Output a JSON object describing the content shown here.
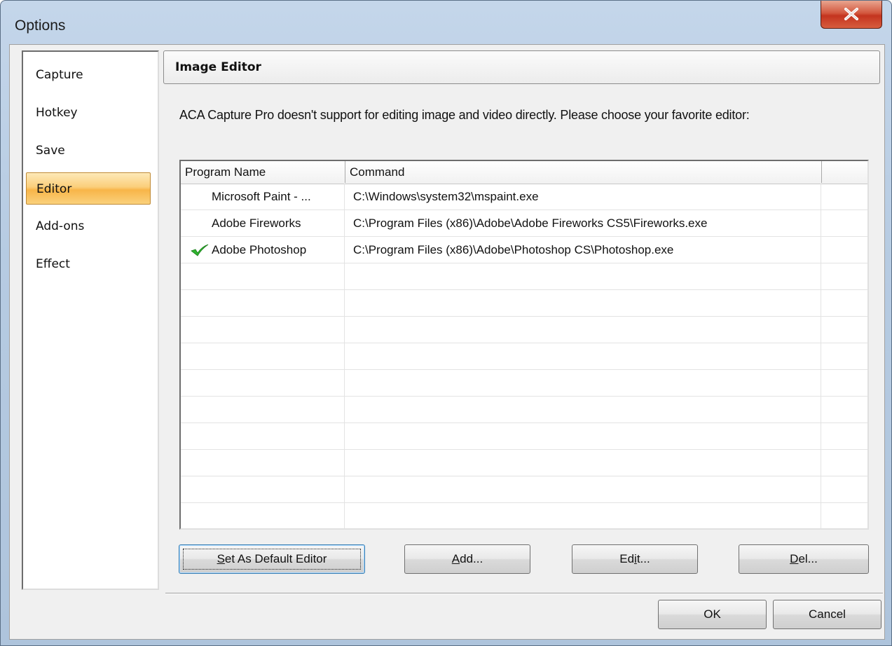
{
  "window": {
    "title": "Options"
  },
  "sidebar": {
    "items": [
      {
        "label": "Capture"
      },
      {
        "label": "Hotkey"
      },
      {
        "label": "Save"
      },
      {
        "label": "Editor",
        "selected": true
      },
      {
        "label": "Add-ons"
      },
      {
        "label": "Effect"
      }
    ]
  },
  "panel": {
    "header": "Image Editor",
    "description": "ACA Capture Pro doesn't support for editing image and video directly. Please choose your favorite editor:"
  },
  "table": {
    "columns": [
      "Program Name",
      "Command",
      ""
    ],
    "rows": [
      {
        "name": "Microsoft Paint - ...",
        "command": "C:\\Windows\\system32\\mspaint.exe",
        "default": false
      },
      {
        "name": "Adobe Fireworks",
        "command": "C:\\Program Files (x86)\\Adobe\\Adobe Fireworks CS5\\Fireworks.exe",
        "default": false
      },
      {
        "name": "Adobe Photoshop",
        "command": "C:\\Program Files (x86)\\Adobe\\Photoshop CS\\Photoshop.exe",
        "default": true
      }
    ]
  },
  "buttons": {
    "set_default": {
      "mnemonic": "S",
      "rest": "et As Default Editor"
    },
    "add": {
      "mnemonic": "A",
      "rest": "dd..."
    },
    "edit": {
      "pre": "Ed",
      "mnemonic": "i",
      "rest": "t..."
    },
    "del": {
      "mnemonic": "D",
      "rest": "el..."
    },
    "ok": "OK",
    "cancel": "Cancel"
  },
  "icons": {
    "close": "close-icon",
    "default_marker": "checkmark-icon"
  },
  "colors": {
    "selected_item": "#f9bf58",
    "checkmark": "#2fb52f",
    "close_button": "#c94a31"
  }
}
